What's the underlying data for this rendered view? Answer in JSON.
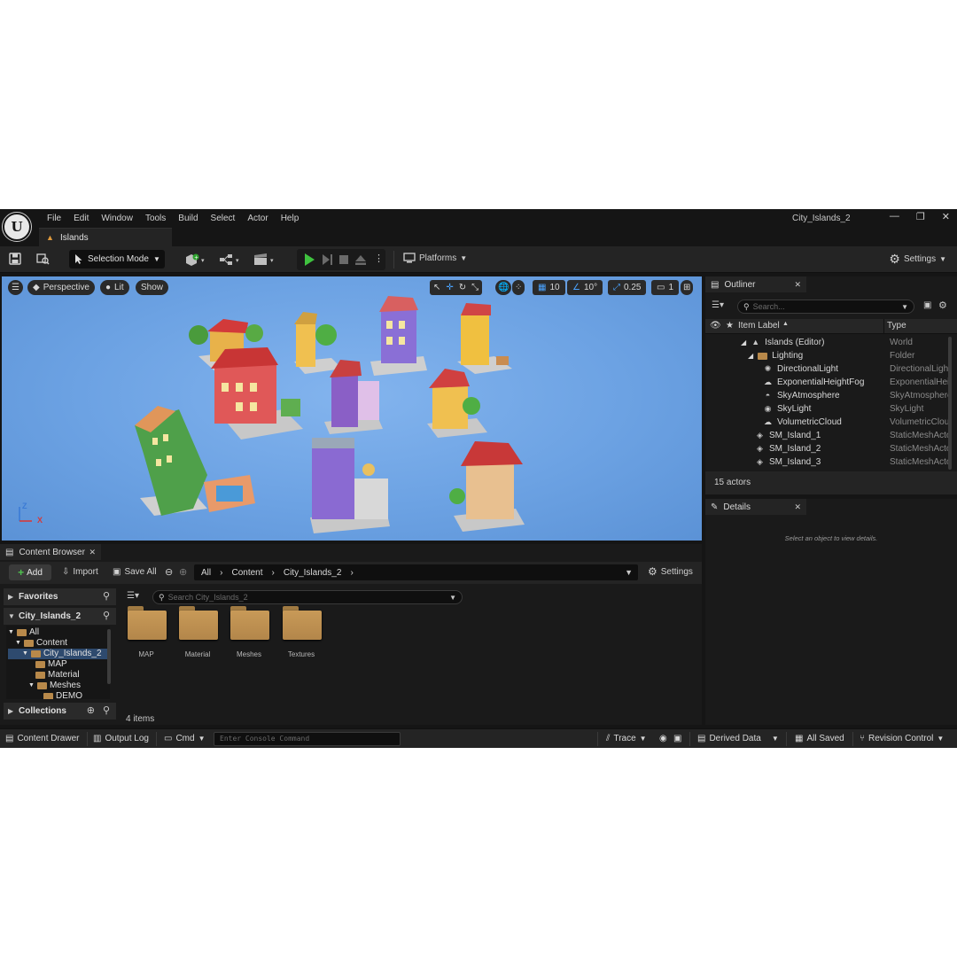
{
  "window": {
    "project_name": "City_Islands_2",
    "menu": [
      "File",
      "Edit",
      "Window",
      "Tools",
      "Build",
      "Select",
      "Actor",
      "Help"
    ],
    "doc_tab": "Islands",
    "controls": {
      "minimize": "—",
      "maximize": "❐",
      "close": "✕"
    }
  },
  "toolbar": {
    "selection_mode": "Selection Mode",
    "platforms": "Platforms",
    "settings": "Settings"
  },
  "viewport": {
    "perspective": "Perspective",
    "lit": "Lit",
    "show": "Show",
    "grid_snap": "10",
    "rotation_snap": "10°",
    "scale_snap": "0.25",
    "camera_speed": "1",
    "axis": {
      "z": "Z",
      "x": "X"
    }
  },
  "outliner": {
    "title": "Outliner",
    "search_placeholder": "Search...",
    "col_label": "Item Label",
    "col_type": "Type",
    "rows": [
      {
        "label": "Islands (Editor)",
        "type": "World"
      },
      {
        "label": "Lighting",
        "type": "Folder"
      },
      {
        "label": "DirectionalLight",
        "type": "DirectionalLight"
      },
      {
        "label": "ExponentialHeightFog",
        "type": "ExponentialHeightFog"
      },
      {
        "label": "SkyAtmosphere",
        "type": "SkyAtmosphere"
      },
      {
        "label": "SkyLight",
        "type": "SkyLight"
      },
      {
        "label": "VolumetricCloud",
        "type": "VolumetricCloud"
      },
      {
        "label": "SM_Island_1",
        "type": "StaticMeshActor"
      },
      {
        "label": "SM_Island_2",
        "type": "StaticMeshActor"
      },
      {
        "label": "SM_Island_3",
        "type": "StaticMeshActor"
      }
    ],
    "actor_count": "15 actors"
  },
  "details": {
    "title": "Details",
    "empty_text": "Select an object to view details."
  },
  "content_browser": {
    "title": "Content Browser",
    "add": "Add",
    "import": "Import",
    "save_all": "Save All",
    "path": [
      "All",
      "Content",
      "City_Islands_2"
    ],
    "settings": "Settings",
    "favorites": "Favorites",
    "project_section": "City_Islands_2",
    "search_placeholder": "Search City_Islands_2",
    "tree": [
      "All",
      "Content",
      "City_Islands_2",
      "MAP",
      "Material",
      "Meshes",
      "DEMO"
    ],
    "assets": [
      "MAP",
      "Material",
      "Meshes",
      "Textures"
    ],
    "items_count": "4 items",
    "collections": "Collections"
  },
  "statusbar": {
    "content_drawer": "Content Drawer",
    "output_log": "Output Log",
    "cmd": "Cmd",
    "console_placeholder": "Enter Console Command",
    "trace": "Trace",
    "derived_data": "Derived Data",
    "all_saved": "All Saved",
    "revision_control": "Revision Control"
  }
}
